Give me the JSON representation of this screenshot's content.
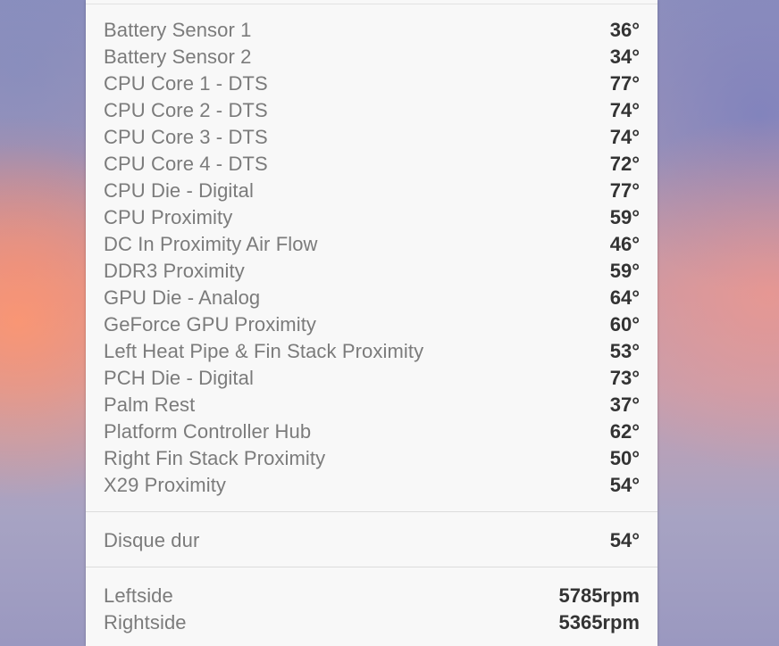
{
  "temperature_sensors": [
    {
      "label": "Battery Sensor 1",
      "value": "36°"
    },
    {
      "label": "Battery Sensor 2",
      "value": "34°"
    },
    {
      "label": "CPU Core 1 - DTS",
      "value": "77°"
    },
    {
      "label": "CPU Core 2 - DTS",
      "value": "74°"
    },
    {
      "label": "CPU Core 3 - DTS",
      "value": "74°"
    },
    {
      "label": "CPU Core 4 - DTS",
      "value": "72°"
    },
    {
      "label": "CPU Die - Digital",
      "value": "77°"
    },
    {
      "label": "CPU Proximity",
      "value": "59°"
    },
    {
      "label": "DC In Proximity Air Flow",
      "value": "46°"
    },
    {
      "label": "DDR3 Proximity",
      "value": "59°"
    },
    {
      "label": "GPU Die - Analog",
      "value": "64°"
    },
    {
      "label": "GeForce GPU Proximity",
      "value": "60°"
    },
    {
      "label": "Left Heat Pipe & Fin Stack Proximity",
      "value": "53°"
    },
    {
      "label": "PCH Die - Digital",
      "value": "73°"
    },
    {
      "label": "Palm Rest",
      "value": "37°"
    },
    {
      "label": "Platform Controller Hub",
      "value": "62°"
    },
    {
      "label": "Right Fin Stack Proximity",
      "value": "50°"
    },
    {
      "label": "X29 Proximity",
      "value": "54°"
    }
  ],
  "drive_sensors": [
    {
      "label": "Disque dur",
      "value": "54°"
    }
  ],
  "fans": [
    {
      "label": "Leftside",
      "value": "5785rpm"
    },
    {
      "label": "Rightside",
      "value": "5365rpm"
    }
  ]
}
